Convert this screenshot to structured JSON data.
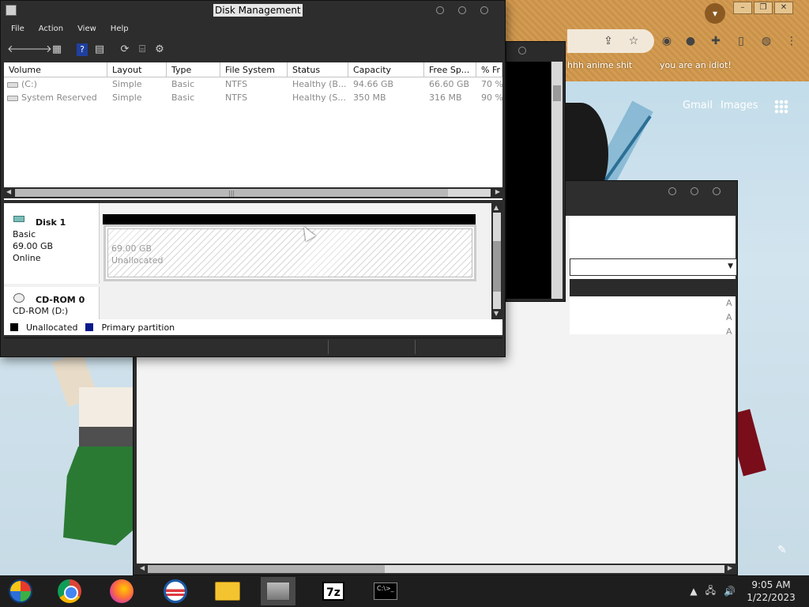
{
  "background_browser": {
    "bookmarks": [
      "hhh anime shit",
      "you are an idiot!"
    ],
    "links": [
      "Gmail",
      "Images"
    ],
    "window_controls": [
      "–",
      "❐",
      "✕"
    ]
  },
  "disk_management": {
    "title": "Disk Management",
    "menu": [
      "File",
      "Action",
      "View",
      "Help"
    ],
    "columns": [
      "Volume",
      "Layout",
      "Type",
      "File System",
      "Status",
      "Capacity",
      "Free Sp...",
      "% Fr"
    ],
    "volumes": [
      {
        "volume": "(C:)",
        "layout": "Simple",
        "type": "Basic",
        "fs": "NTFS",
        "status": "Healthy (B...",
        "capacity": "94.66 GB",
        "free": "66.60 GB",
        "pct": "70 %"
      },
      {
        "volume": "System Reserved",
        "layout": "Simple",
        "type": "Basic",
        "fs": "NTFS",
        "status": "Healthy (S...",
        "capacity": "350 MB",
        "free": "316 MB",
        "pct": "90 %"
      }
    ],
    "disk1": {
      "name": "Disk 1",
      "type": "Basic",
      "size": "69.00 GB",
      "state": "Online",
      "partition": {
        "size": "69.00 GB",
        "label": "Unallocated"
      }
    },
    "cdrom": {
      "name": "CD-ROM 0",
      "drive": "CD-ROM (D:)"
    },
    "legend": [
      {
        "label": "Unallocated",
        "color": "#000000"
      },
      {
        "label": "Primary partition",
        "color": "#0a1a8a"
      }
    ]
  },
  "bigwin": {
    "list_letters": [
      "A",
      "A",
      "A"
    ]
  },
  "taskbar": {
    "apps": [
      "start-orb",
      "chrome",
      "firefox",
      "obama",
      "file-explorer",
      "disk-management",
      "7-zip",
      "command-prompt"
    ],
    "z7_label": "7z",
    "cmd_label": "C:\\>_",
    "time": "9:05 AM",
    "date": "1/22/2023"
  }
}
